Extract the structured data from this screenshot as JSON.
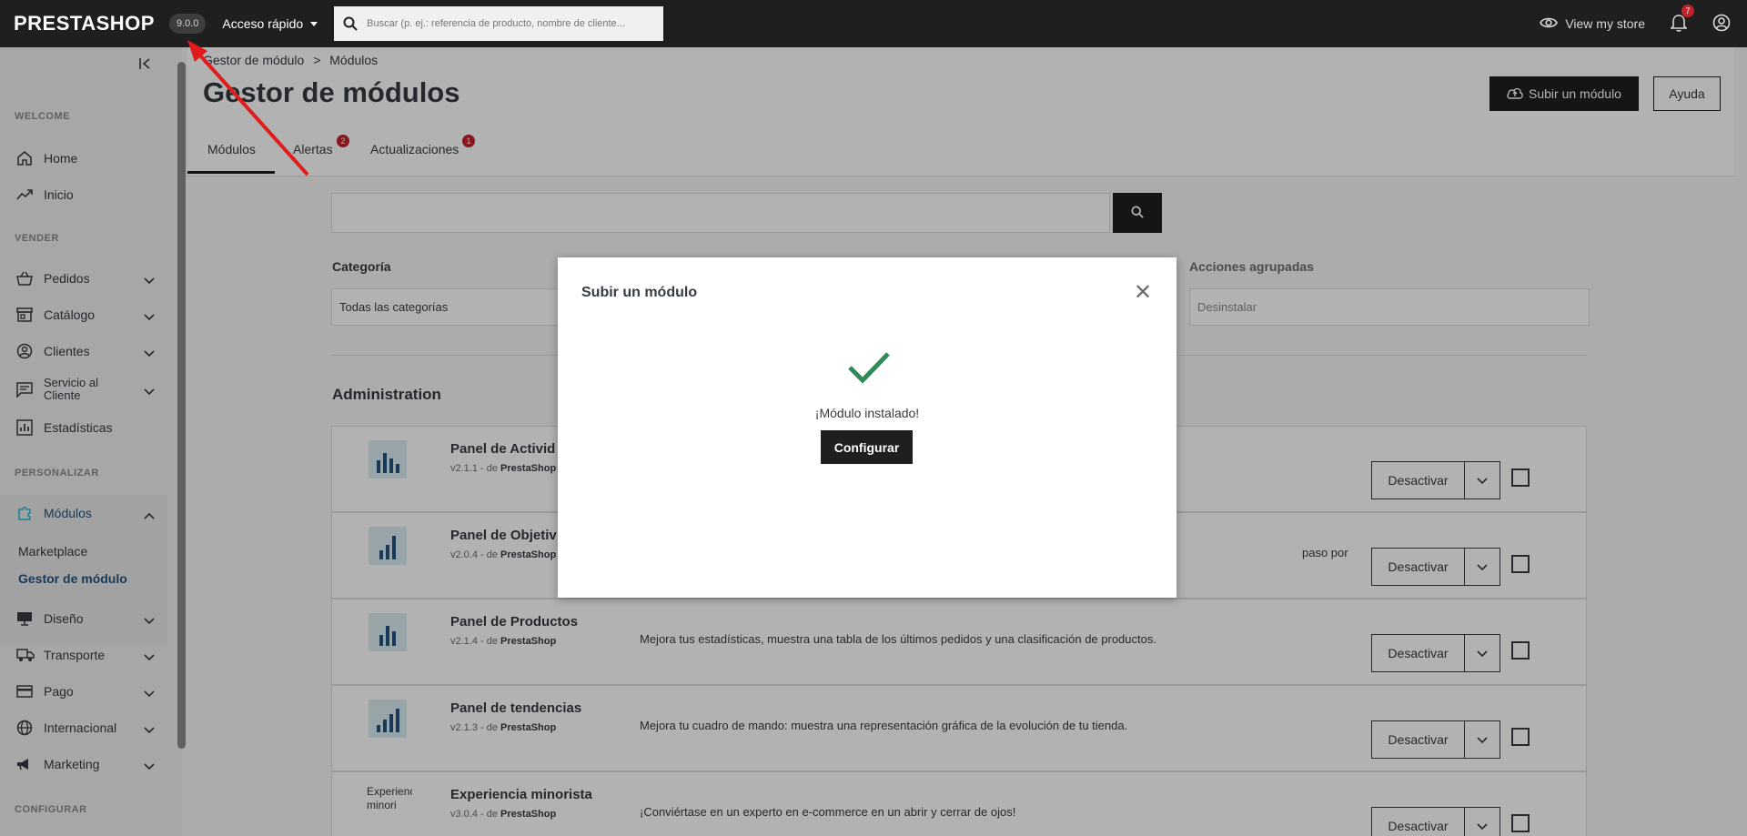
{
  "topbar": {
    "logo": "PRESTASHOP",
    "version": "9.0.0",
    "quick_access": "Acceso rápido",
    "search_placeholder": "Buscar (p. ej.: referencia de producto, nombre de cliente...",
    "view_store": "View my store",
    "notifications_count": "7"
  },
  "sidebar": {
    "sections": {
      "welcome": "WELCOME",
      "vender": "VENDER",
      "personalizar": "PERSONALIZAR",
      "configurar": "CONFIGURAR"
    },
    "items": {
      "home": "Home",
      "inicio": "Inicio",
      "pedidos": "Pedidos",
      "catalogo": "Catálogo",
      "clientes": "Clientes",
      "servicio_line1": "Servicio al",
      "servicio_line2": "Cliente",
      "estadisticas": "Estadísticas",
      "modulos": "Módulos",
      "marketplace": "Marketplace",
      "gestor": "Gestor de módulo",
      "diseno": "Diseño",
      "transporte": "Transporte",
      "pago": "Pago",
      "internacional": "Internacional",
      "marketing": "Marketing"
    }
  },
  "header": {
    "breadcrumb_parent": "Gestor de módulo",
    "breadcrumb_sep": ">",
    "breadcrumb_current": "Módulos",
    "title": "Gestor de módulos",
    "upload_button": "Subir un módulo",
    "help_button": "Ayuda",
    "tabs": [
      {
        "label": "Módulos",
        "badge": ""
      },
      {
        "label": "Alertas",
        "badge": "2"
      },
      {
        "label": "Actualizaciones",
        "badge": "1"
      }
    ]
  },
  "filters": {
    "category_label": "Categoría",
    "category_value": "Todas las categorías",
    "bulk_label": "Acciones agrupadas",
    "bulk_value": "Desinstalar"
  },
  "category_title": "Administration",
  "modules": [
    {
      "name": "Panel de Activid",
      "version": "v2.1.1 - de",
      "author": "PrestaShop",
      "description": "",
      "action": "Desactivar"
    },
    {
      "name": "Panel de Objetiv",
      "version": "v2.0.4 - de",
      "author": "PrestaShop",
      "description": "paso por",
      "action": "Desactivar"
    },
    {
      "name": "Panel de Productos",
      "version": "v2.1.4 - de",
      "author": "PrestaShop",
      "description": "Mejora tus estadísticas, muestra una tabla de los últimos pedidos y una clasificación de productos.",
      "action": "Desactivar"
    },
    {
      "name": "Panel de tendencias",
      "version": "v2.1.3 - de",
      "author": "PrestaShop",
      "description": "Mejora tu cuadro de mando: muestra una representación gráfica de la evolución de tu tienda.",
      "action": "Desactivar"
    },
    {
      "name": "Experiencia minorista",
      "version": "v3.0.4 - de",
      "author": "PrestaShop",
      "description": "¡Conviértase en un experto en e-commerce en un abrir y cerrar de ojos!",
      "action": "Desactivar",
      "image_alt": "Experiencia minori"
    }
  ],
  "modal": {
    "title": "Subir un módulo",
    "message": "¡Módulo instalado!",
    "button": "Configurar"
  },
  "colors": {
    "topbar": "#1f1f1f",
    "accent_active": "#25b9d7",
    "submenu_active": "#25527e",
    "success_check": "#2e8b57",
    "badge": "#c0212a",
    "arrow": "#e01b1b"
  }
}
